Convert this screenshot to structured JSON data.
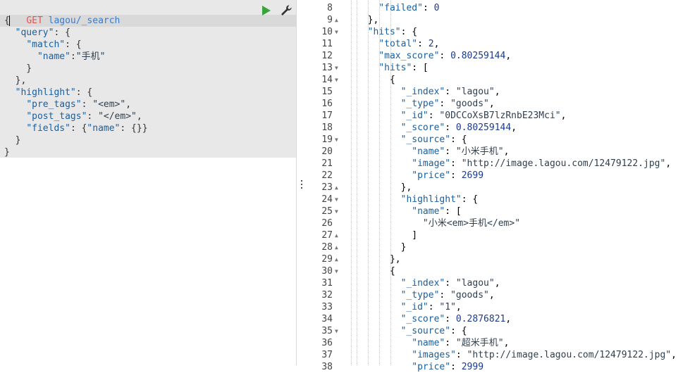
{
  "request": {
    "method": "GET",
    "path": "lagou/_search",
    "body_lines": [
      "{",
      "  \"query\": {",
      "    \"match\": {",
      "      \"name\":\"手机\"",
      "    }",
      "  },",
      "  \"highlight\": {",
      "    \"pre_tags\": \"<em>\",",
      "    \"post_tags\": \"</em>\",",
      "    \"fields\": {\"name\": {}}",
      "  }",
      "}"
    ]
  },
  "toolbar": {
    "run_icon": "play-icon",
    "settings_icon": "wrench-icon",
    "resize_icon": "vertical-dots-icon"
  },
  "response": {
    "lines": [
      {
        "num": "8",
        "fold": "",
        "text": "    \"failed\": 0"
      },
      {
        "num": "9",
        "fold": "▲",
        "text": "  },"
      },
      {
        "num": "10",
        "fold": "▼",
        "text": "  \"hits\": {"
      },
      {
        "num": "11",
        "fold": "",
        "text": "    \"total\": 2,"
      },
      {
        "num": "12",
        "fold": "",
        "text": "    \"max_score\": 0.80259144,"
      },
      {
        "num": "13",
        "fold": "▼",
        "text": "    \"hits\": ["
      },
      {
        "num": "14",
        "fold": "▼",
        "text": "      {"
      },
      {
        "num": "15",
        "fold": "",
        "text": "        \"_index\": \"lagou\","
      },
      {
        "num": "16",
        "fold": "",
        "text": "        \"_type\": \"goods\","
      },
      {
        "num": "17",
        "fold": "",
        "text": "        \"_id\": \"0DCCoXsB7lzRnbE23Mci\","
      },
      {
        "num": "18",
        "fold": "",
        "text": "        \"_score\": 0.80259144,"
      },
      {
        "num": "19",
        "fold": "▼",
        "text": "        \"_source\": {"
      },
      {
        "num": "20",
        "fold": "",
        "text": "          \"name\": \"小米手机\","
      },
      {
        "num": "21",
        "fold": "",
        "text": "          \"image\": \"http://image.lagou.com/12479122.jpg\","
      },
      {
        "num": "22",
        "fold": "",
        "text": "          \"price\": 2699"
      },
      {
        "num": "23",
        "fold": "▲",
        "text": "        },"
      },
      {
        "num": "24",
        "fold": "▼",
        "text": "        \"highlight\": {"
      },
      {
        "num": "25",
        "fold": "▼",
        "text": "          \"name\": ["
      },
      {
        "num": "26",
        "fold": "",
        "text": "            \"小米<em>手机</em>\""
      },
      {
        "num": "27",
        "fold": "▲",
        "text": "          ]"
      },
      {
        "num": "28",
        "fold": "▲",
        "text": "        }"
      },
      {
        "num": "29",
        "fold": "▲",
        "text": "      },"
      },
      {
        "num": "30",
        "fold": "▼",
        "text": "      {"
      },
      {
        "num": "31",
        "fold": "",
        "text": "        \"_index\": \"lagou\","
      },
      {
        "num": "32",
        "fold": "",
        "text": "        \"_type\": \"goods\","
      },
      {
        "num": "33",
        "fold": "",
        "text": "        \"_id\": \"1\","
      },
      {
        "num": "34",
        "fold": "",
        "text": "        \"_score\": 0.2876821,"
      },
      {
        "num": "35",
        "fold": "▼",
        "text": "        \"_source\": {"
      },
      {
        "num": "36",
        "fold": "",
        "text": "          \"name\": \"超米手机\","
      },
      {
        "num": "37",
        "fold": "",
        "text": "          \"images\": \"http://image.lagou.com/12479122.jpg\","
      },
      {
        "num": "38",
        "fold": "",
        "text": "          \"price\": 2999"
      }
    ]
  },
  "colors": {
    "method": "#e0524d",
    "url": "#3a7bc8",
    "run": "#3aa33a",
    "key": "#1a5fa0",
    "number": "#1b3a8a"
  }
}
